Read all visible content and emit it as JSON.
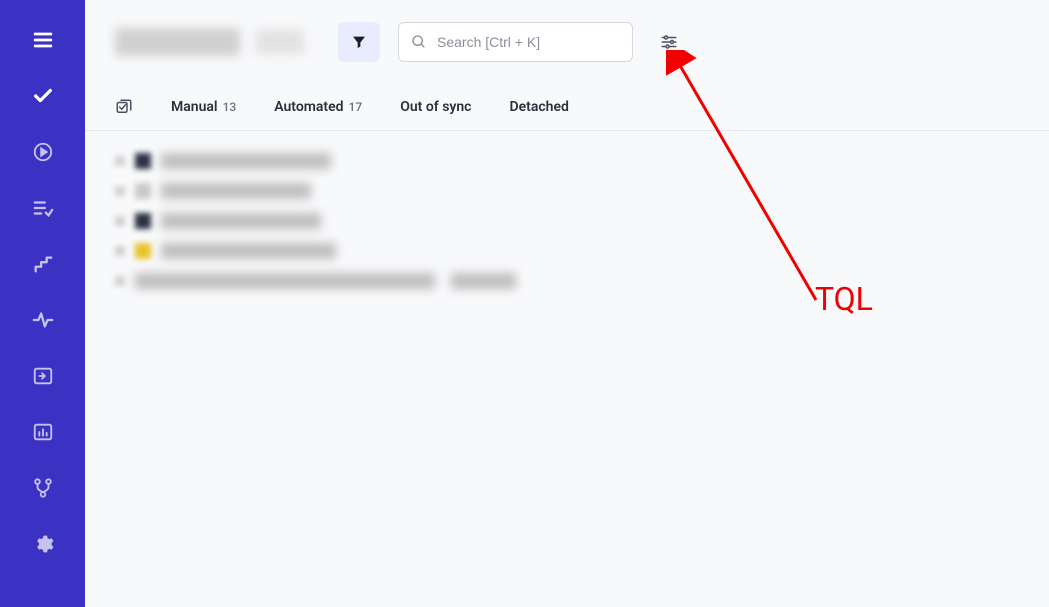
{
  "sidebar": {
    "items": [
      {
        "name": "menu",
        "icon": "hamburger"
      },
      {
        "name": "approved",
        "icon": "check"
      },
      {
        "name": "runs",
        "icon": "play-circle"
      },
      {
        "name": "results",
        "icon": "list-check"
      },
      {
        "name": "steps",
        "icon": "stairs"
      },
      {
        "name": "activity",
        "icon": "pulse"
      },
      {
        "name": "import",
        "icon": "import"
      },
      {
        "name": "reports",
        "icon": "bar-chart"
      },
      {
        "name": "branches",
        "icon": "git-branch"
      },
      {
        "name": "settings",
        "icon": "gear"
      }
    ]
  },
  "search": {
    "placeholder": "Search [Ctrl + K]"
  },
  "tabs": [
    {
      "label": "Manual",
      "count": "13"
    },
    {
      "label": "Automated",
      "count": "17"
    },
    {
      "label": "Out of sync",
      "count": ""
    },
    {
      "label": "Detached",
      "count": ""
    }
  ],
  "annotation": {
    "label": "TQL"
  }
}
